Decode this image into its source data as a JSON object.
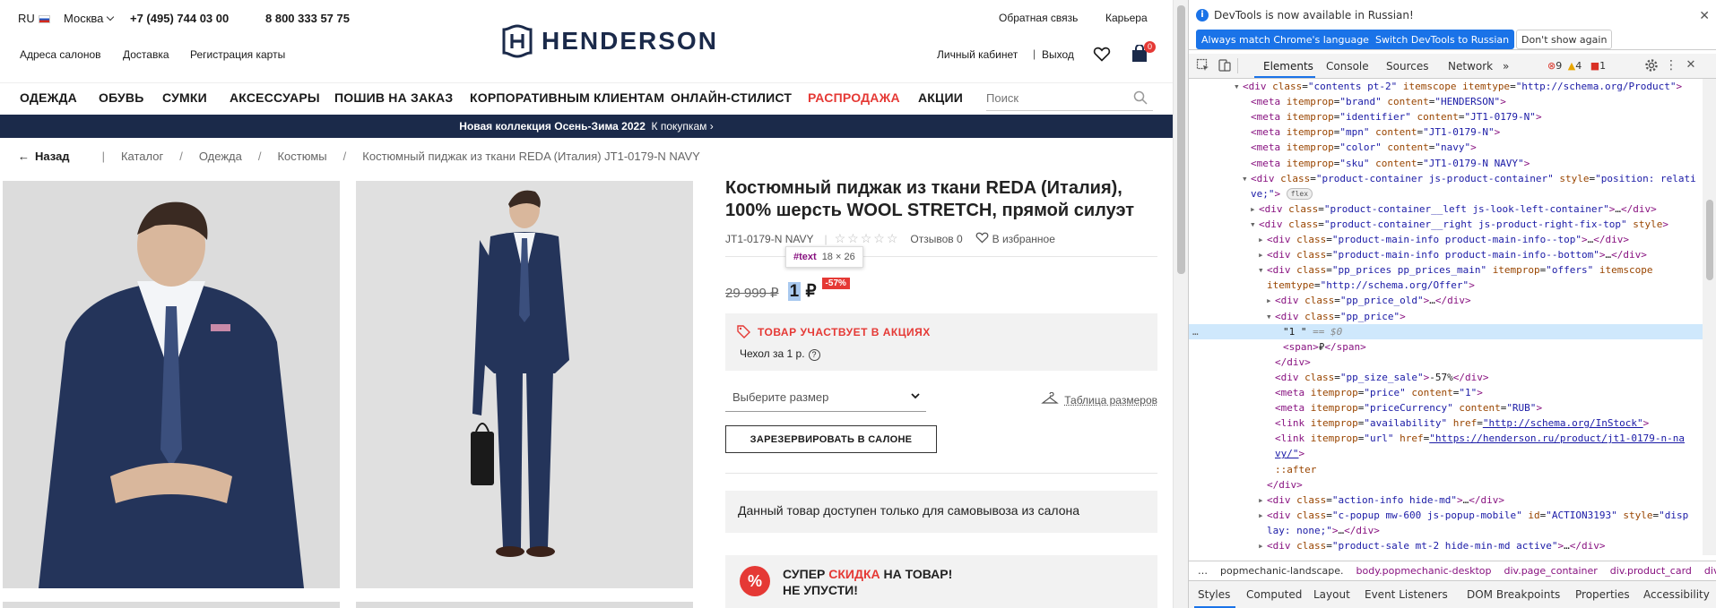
{
  "header": {
    "lang": "RU",
    "city": "Москва",
    "phone1": "+7 (495) 744 03 00",
    "phone2": "8 800 333 57 75",
    "links_left": [
      "Адреса салонов",
      "Доставка",
      "Регистрация карты"
    ],
    "feedback": "Обратная связь",
    "career": "Карьера",
    "account": "Личный кабинет",
    "divider": "|",
    "logout": "Выход",
    "cart_count": "0",
    "logo_text": "HENDERSON"
  },
  "nav": {
    "items": [
      "ОДЕЖДА",
      "ОБУВЬ",
      "СУМКИ",
      "АКСЕССУАРЫ",
      "ПОШИВ НА ЗАКАЗ",
      "КОРПОРАТИВНЫМ КЛИЕНТАМ",
      "ОНЛАЙН-СТИЛИСТ",
      "РАСПРОДАЖА",
      "АКЦИИ"
    ],
    "search_placeholder": "Поиск"
  },
  "promo": {
    "text": "Новая коллекция Осень-Зима 2022",
    "link": "К покупкам ›"
  },
  "breadcrumb": {
    "back": "Назад",
    "items": [
      "Каталог",
      "Одежда",
      "Костюмы",
      "Костюмный пиджак из ткани REDA (Италия) JT1-0179-N NAVY"
    ]
  },
  "product": {
    "title": "Костюмный пиджак из ткани REDA (Италия), 100% шерсть WOOL STRETCH, прямой силуэт",
    "sku": "JT1-0179-N NAVY",
    "stars": "☆☆☆☆☆",
    "reviews": "Отзывов 0",
    "favorite": "В избранное",
    "old_price": "29 999 ₽",
    "new_price_value": "1",
    "currency": "₽",
    "discount": "-57%",
    "tooltip_node": "#text",
    "tooltip_size": "18 × 26",
    "action_title": "ТОВАР УЧАСТВУЕТ В АКЦИЯХ",
    "action_text": "Чехол за 1 р.",
    "size_placeholder": "Выберите размер",
    "size_table": "Таблица размеров",
    "reserve": "ЗАРЕЗЕРВИРОВАТЬ В САЛОНЕ",
    "pickup": "Данный товар доступен только для самовывоза из салона",
    "super_line1_a": "СУПЕР ",
    "super_line1_b": "СКИДКА",
    "super_line1_c": " НА ТОВАР!",
    "super_line2": "НЕ УПУСТИ!",
    "super_icon": "%"
  },
  "devtools": {
    "info": "DevTools is now available in Russian!",
    "btn1": "Always match Chrome's language",
    "btn2": "Switch DevTools to Russian",
    "btn3": "Don't show again",
    "tabs": [
      "Elements",
      "Console",
      "Sources",
      "Network"
    ],
    "more": "»",
    "errors": "9",
    "warnings": "4",
    "issues": "1",
    "crumbs": [
      "…",
      "popmechanic-landscape.",
      "body.popmechanic-desktop",
      "div.page_container",
      "div.product_card",
      "div"
    ],
    "subtabs": [
      "Styles",
      "Computed",
      "Layout",
      "Event Listeners",
      "DOM Breakpoints",
      "Properties",
      "Accessibility"
    ],
    "lines": [
      {
        "i": 3,
        "tri": "▾",
        "h": "<span class='tag'>&lt;div</span> <span class='attr'>class</span>=<span class='val'>\"contents pt-2\"</span> <span class='attr'>itemscope</span> <span class='attr'>itemtype</span>=<span class='val'>\"http://schema.org/Product\"</span><span class='tag'>&gt;</span>"
      },
      {
        "i": 4,
        "tri": "",
        "h": "<span class='tag'>&lt;meta</span> <span class='attr'>itemprop</span>=<span class='val'>\"brand\"</span> <span class='attr'>content</span>=<span class='val'>\"HENDERSON\"</span><span class='tag'>&gt;</span>"
      },
      {
        "i": 4,
        "tri": "",
        "h": "<span class='tag'>&lt;meta</span> <span class='attr'>itemprop</span>=<span class='val'>\"identifier\"</span> <span class='attr'>content</span>=<span class='val'>\"JT1-0179-N\"</span><span class='tag'>&gt;</span>"
      },
      {
        "i": 4,
        "tri": "",
        "h": "<span class='tag'>&lt;meta</span> <span class='attr'>itemprop</span>=<span class='val'>\"mpn\"</span> <span class='attr'>content</span>=<span class='val'>\"JT1-0179-N\"</span><span class='tag'>&gt;</span>"
      },
      {
        "i": 4,
        "tri": "",
        "h": "<span class='tag'>&lt;meta</span> <span class='attr'>itemprop</span>=<span class='val'>\"color\"</span> <span class='attr'>content</span>=<span class='val'>\"navy\"</span><span class='tag'>&gt;</span>"
      },
      {
        "i": 4,
        "tri": "",
        "h": "<span class='tag'>&lt;meta</span> <span class='attr'>itemprop</span>=<span class='val'>\"sku\"</span> <span class='attr'>content</span>=<span class='val'>\"JT1-0179-N NAVY\"</span><span class='tag'>&gt;</span>"
      },
      {
        "i": 4,
        "tri": "▾",
        "h": "<span class='tag'>&lt;div</span> <span class='attr'>class</span>=<span class='val'>\"product-container js-product-container\"</span> <span class='attr'>style</span>=<span class='val'>\"position: relati</span>"
      },
      {
        "i": 4,
        "tri": "",
        "h": "<span class='val'>ve;\"</span><span class='tag'>&gt;</span> <span class='flexpill'>flex</span>"
      },
      {
        "i": 5,
        "tri": "▸",
        "h": "<span class='tag'>&lt;div</span> <span class='attr'>class</span>=<span class='val'>\"product-container__left js-look-left-container\"</span><span class='tag'>&gt;</span>…<span class='tag'>&lt;/div&gt;</span>"
      },
      {
        "i": 5,
        "tri": "▾",
        "h": "<span class='tag'>&lt;div</span> <span class='attr'>class</span>=<span class='val'>\"product-container__right js-product-right-fix-top\"</span> <span class='attr'>style</span><span class='tag'>&gt;</span>"
      },
      {
        "i": 6,
        "tri": "▸",
        "h": "<span class='tag'>&lt;div</span> <span class='attr'>class</span>=<span class='val'>\"product-main-info product-main-info--top\"</span><span class='tag'>&gt;</span>…<span class='tag'>&lt;/div&gt;</span>"
      },
      {
        "i": 6,
        "tri": "▸",
        "h": "<span class='tag'>&lt;div</span> <span class='attr'>class</span>=<span class='val'>\"product-main-info product-main-info--bottom\"</span><span class='tag'>&gt;</span>…<span class='tag'>&lt;/div&gt;</span>"
      },
      {
        "i": 6,
        "tri": "▾",
        "h": "<span class='tag'>&lt;div</span> <span class='attr'>class</span>=<span class='val'>\"pp_prices pp_prices_main\"</span> <span class='attr'>itemprop</span>=<span class='val'>\"offers\"</span> <span class='attr'>itemscope</span>"
      },
      {
        "i": 6,
        "tri": "",
        "h": "<span class='attr'>itemtype</span>=<span class='val'>\"http://schema.org/Offer\"</span><span class='tag'>&gt;</span>"
      },
      {
        "i": 7,
        "tri": "▸",
        "h": "<span class='tag'>&lt;div</span> <span class='attr'>class</span>=<span class='val'>\"pp_price_old\"</span><span class='tag'>&gt;</span>…<span class='tag'>&lt;/div&gt;</span>"
      },
      {
        "i": 7,
        "tri": "▾",
        "h": "<span class='tag'>&lt;div</span> <span class='attr'>class</span>=<span class='val'>\"pp_price\"</span><span class='tag'>&gt;</span>"
      },
      {
        "i": 8,
        "tri": "",
        "sel": true,
        "h": "<span class='txt'>\"1 \"</span> <span class='dim'>== $0</span>"
      },
      {
        "i": 8,
        "tri": "",
        "h": "<span class='tag'>&lt;span&gt;</span>₽<span class='tag'>&lt;/span&gt;</span>"
      },
      {
        "i": 7,
        "tri": "",
        "h": "<span class='tag'>&lt;/div&gt;</span>"
      },
      {
        "i": 7,
        "tri": "",
        "h": "<span class='tag'>&lt;div</span> <span class='attr'>class</span>=<span class='val'>\"pp_size_sale\"</span><span class='tag'>&gt;</span>-57%<span class='tag'>&lt;/div&gt;</span>"
      },
      {
        "i": 7,
        "tri": "",
        "h": "<span class='tag'>&lt;meta</span> <span class='attr'>itemprop</span>=<span class='val'>\"price\"</span> <span class='attr'>content</span>=<span class='val'>\"1\"</span><span class='tag'>&gt;</span>"
      },
      {
        "i": 7,
        "tri": "",
        "h": "<span class='tag'>&lt;meta</span> <span class='attr'>itemprop</span>=<span class='val'>\"priceCurrency\"</span> <span class='attr'>content</span>=<span class='val'>\"RUB\"</span><span class='tag'>&gt;</span>"
      },
      {
        "i": 7,
        "tri": "",
        "h": "<span class='tag'>&lt;link</span> <span class='attr'>itemprop</span>=<span class='val'>\"availability\"</span> <span class='attr'>href</span>=<span class='link'>\"http://schema.org/InStock\"</span><span class='tag'>&gt;</span>"
      },
      {
        "i": 7,
        "tri": "",
        "h": "<span class='tag'>&lt;link</span> <span class='attr'>itemprop</span>=<span class='val'>\"url\"</span> <span class='attr'>href</span>=<span class='link'>\"https://henderson.ru/product/jt1-0179-n-na</span>"
      },
      {
        "i": 7,
        "tri": "",
        "h": "<span class='link'>vy/\"</span><span class='tag'>&gt;</span>"
      },
      {
        "i": 7,
        "tri": "",
        "h": "<span class='attr'>::after</span>"
      },
      {
        "i": 6,
        "tri": "",
        "h": "<span class='tag'>&lt;/div&gt;</span>"
      },
      {
        "i": 6,
        "tri": "▸",
        "h": "<span class='tag'>&lt;div</span> <span class='attr'>class</span>=<span class='val'>\"action-info hide-md\"</span><span class='tag'>&gt;</span>…<span class='tag'>&lt;/div&gt;</span>"
      },
      {
        "i": 6,
        "tri": "▸",
        "h": "<span class='tag'>&lt;div</span> <span class='attr'>class</span>=<span class='val'>\"c-popup mw-600 js-popup-mobile\"</span> <span class='attr'>id</span>=<span class='val'>\"ACTION3193\"</span> <span class='attr'>style</span>=<span class='val'>\"disp</span>"
      },
      {
        "i": 6,
        "tri": "",
        "h": "<span class='val'>lay: none;\"</span><span class='tag'>&gt;</span>…<span class='tag'>&lt;/div&gt;</span>"
      },
      {
        "i": 6,
        "tri": "▸",
        "h": "<span class='tag'>&lt;div</span> <span class='attr'>class</span>=<span class='val'>\"product-sale mt-2 hide-min-md active\"</span><span class='tag'>&gt;</span>…<span class='tag'>&lt;/div&gt;</span>"
      }
    ]
  },
  "colors": {
    "brand_navy": "#1b2a4a",
    "sale_red": "#e53935",
    "devtools_blue": "#1a73e8",
    "selection": "#cfe8fc"
  }
}
